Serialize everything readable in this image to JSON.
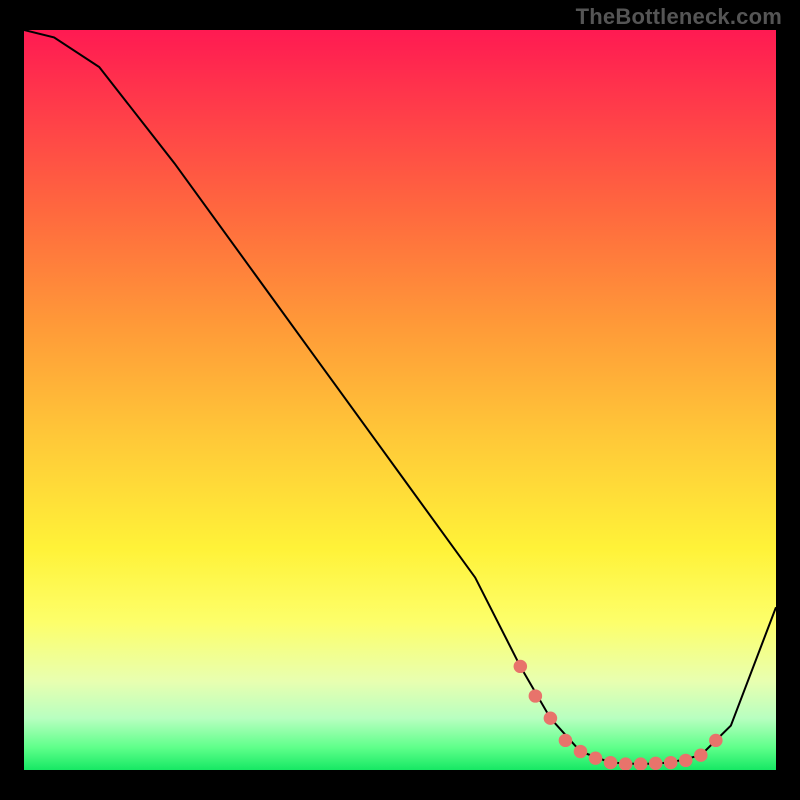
{
  "watermark": "TheBottleneck.com",
  "chart_data": {
    "type": "line",
    "title": "",
    "xlabel": "",
    "ylabel": "",
    "xlim": [
      0,
      100
    ],
    "ylim": [
      0,
      100
    ],
    "grid": false,
    "series": [
      {
        "name": "bottleneck-curve",
        "x": [
          0,
          4,
          10,
          20,
          30,
          40,
          50,
          60,
          66,
          70,
          74,
          78,
          82,
          86,
          90,
          94,
          100
        ],
        "y": [
          100,
          99,
          95,
          82,
          68,
          54,
          40,
          26,
          14,
          7,
          2.5,
          1,
          0.8,
          1,
          2,
          6,
          22
        ],
        "color": "#000000"
      }
    ],
    "markers": {
      "name": "optimal-zone-markers",
      "color": "#e8736b",
      "points": [
        {
          "x": 66,
          "y": 14
        },
        {
          "x": 68,
          "y": 10
        },
        {
          "x": 70,
          "y": 7
        },
        {
          "x": 72,
          "y": 4
        },
        {
          "x": 74,
          "y": 2.5
        },
        {
          "x": 76,
          "y": 1.6
        },
        {
          "x": 78,
          "y": 1
        },
        {
          "x": 80,
          "y": 0.8
        },
        {
          "x": 82,
          "y": 0.8
        },
        {
          "x": 84,
          "y": 0.9
        },
        {
          "x": 86,
          "y": 1
        },
        {
          "x": 88,
          "y": 1.3
        },
        {
          "x": 90,
          "y": 2
        },
        {
          "x": 92,
          "y": 4
        }
      ]
    },
    "gradient_stops": [
      {
        "pos": 0,
        "color": "#ff1a52"
      },
      {
        "pos": 10,
        "color": "#ff3a4a"
      },
      {
        "pos": 25,
        "color": "#ff6a3e"
      },
      {
        "pos": 40,
        "color": "#ff9a38"
      },
      {
        "pos": 55,
        "color": "#ffc838"
      },
      {
        "pos": 70,
        "color": "#fff238"
      },
      {
        "pos": 80,
        "color": "#fdff6a"
      },
      {
        "pos": 88,
        "color": "#e8ffb0"
      },
      {
        "pos": 93,
        "color": "#b8ffc0"
      },
      {
        "pos": 97,
        "color": "#5eff8a"
      },
      {
        "pos": 100,
        "color": "#16e864"
      }
    ]
  }
}
